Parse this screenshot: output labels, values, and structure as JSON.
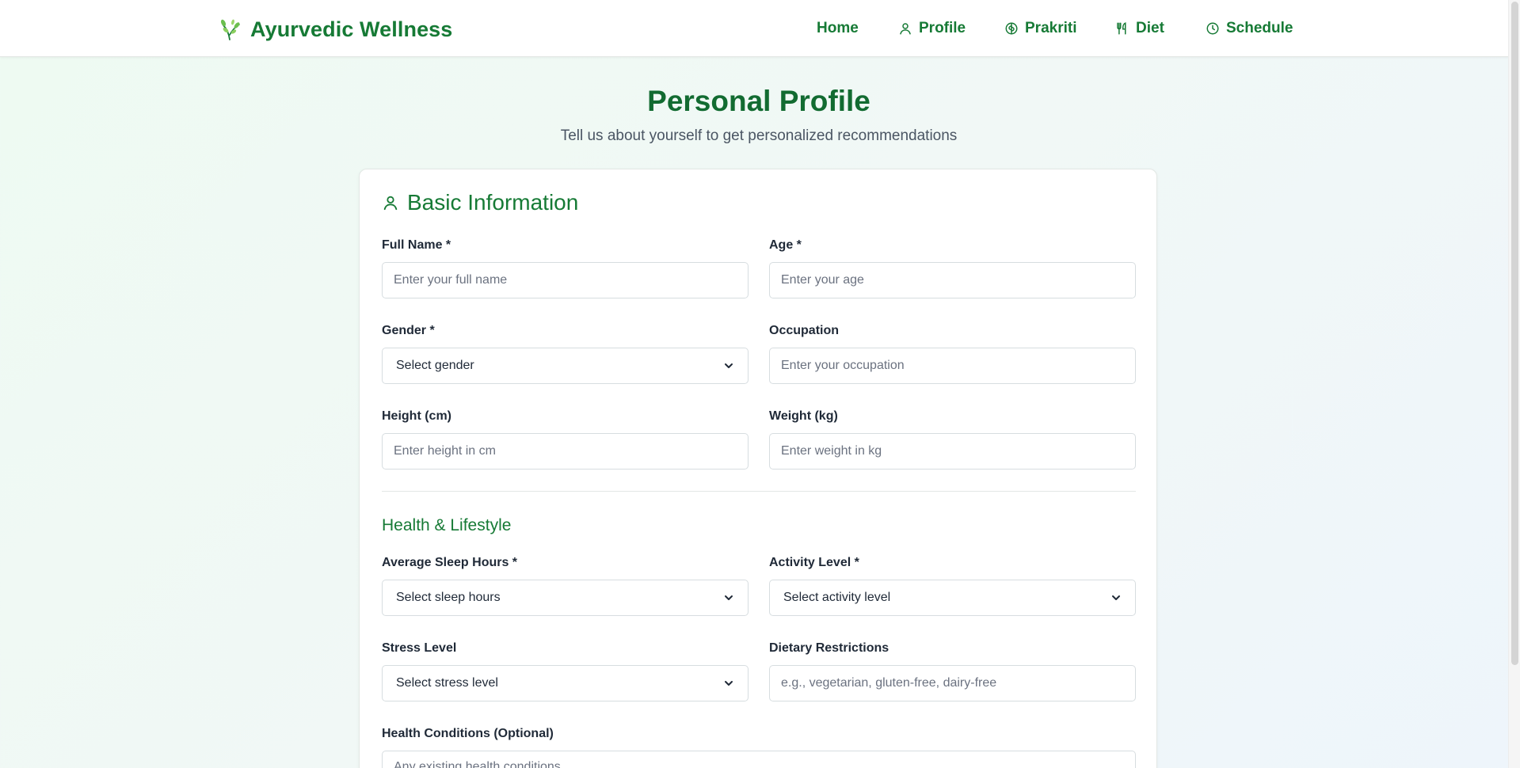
{
  "header": {
    "brand": "Ayurvedic Wellness",
    "brand_icon": "leaf-icon",
    "nav": [
      {
        "label": "Home",
        "icon": ""
      },
      {
        "label": "Profile",
        "icon": "user-icon"
      },
      {
        "label": "Prakriti",
        "icon": "brain-icon"
      },
      {
        "label": "Diet",
        "icon": "utensils-icon"
      },
      {
        "label": "Schedule",
        "icon": "clock-icon"
      }
    ]
  },
  "page": {
    "title": "Personal Profile",
    "subtitle": "Tell us about yourself to get personalized recommendations"
  },
  "basic_info": {
    "title": "Basic Information",
    "icon": "user-icon",
    "full_name": {
      "label": "Full Name *",
      "placeholder": "Enter your full name"
    },
    "age": {
      "label": "Age *",
      "placeholder": "Enter your age"
    },
    "gender": {
      "label": "Gender *",
      "value": "Select gender"
    },
    "occupation": {
      "label": "Occupation",
      "placeholder": "Enter your occupation"
    },
    "height": {
      "label": "Height (cm)",
      "placeholder": "Enter height in cm"
    },
    "weight": {
      "label": "Weight (kg)",
      "placeholder": "Enter weight in kg"
    }
  },
  "health": {
    "title": "Health & Lifestyle",
    "sleep": {
      "label": "Average Sleep Hours *",
      "value": "Select sleep hours"
    },
    "activity": {
      "label": "Activity Level *",
      "value": "Select activity level"
    },
    "stress": {
      "label": "Stress Level",
      "value": "Select stress level"
    },
    "dietary": {
      "label": "Dietary Restrictions",
      "placeholder": "e.g., vegetarian, gluten-free, dairy-free"
    },
    "conditions": {
      "label": "Health Conditions (Optional)",
      "placeholder": "Any existing health conditions"
    }
  },
  "colors": {
    "brand": "#167a35",
    "title": "#126b31",
    "border": "#d7dde0"
  }
}
